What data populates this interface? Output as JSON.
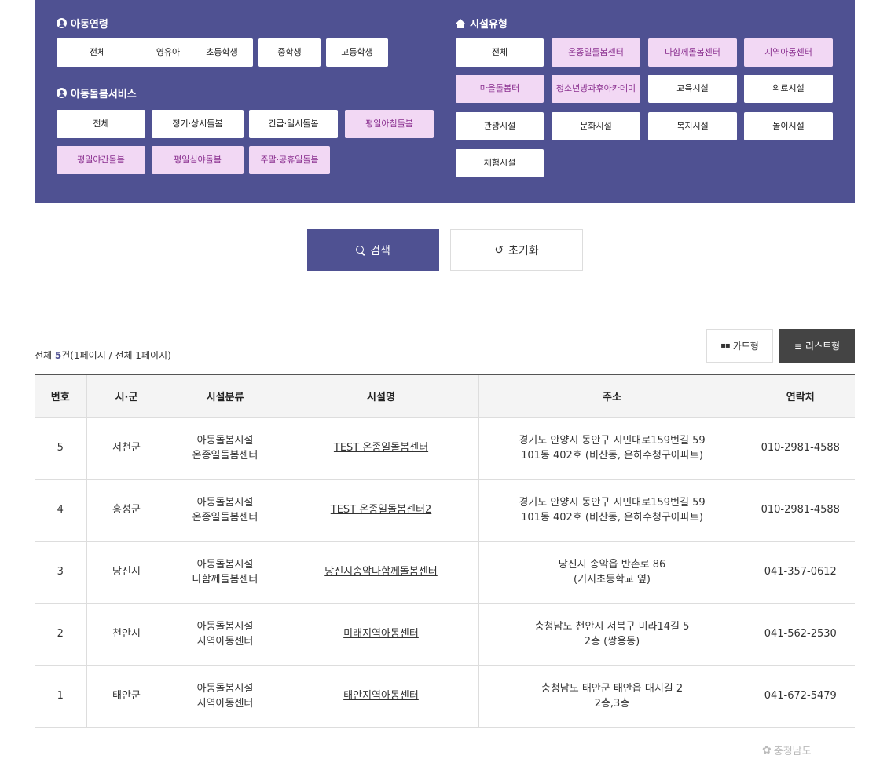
{
  "filters": {
    "age": {
      "title": "아동연령",
      "options": [
        "전체",
        "영유아",
        "초등학생",
        "중학생",
        "고등학생"
      ]
    },
    "service": {
      "title": "아동돌봄서비스",
      "options": [
        "전체",
        "정기·상시돌봄",
        "긴급·일시돌봄",
        "평일아침돌봄",
        "평일야간돌봄",
        "평일심야돌봄",
        "주말·공휴일돌봄"
      ]
    },
    "facility": {
      "title": "시설유형",
      "options": [
        "전체",
        "온종일돌봄센터",
        "다함께돌봄센터",
        "지역아동센터",
        "마을돌봄터",
        "청소년방과후아카데미",
        "교육시설",
        "의료시설",
        "관광시설",
        "문화시설",
        "복지시설",
        "놀이시설",
        "체험시설"
      ]
    },
    "selected_color": "#f2d8f4",
    "panel_color": "#4f5192"
  },
  "actions": {
    "search_label": "검색",
    "reset_label": "초기화"
  },
  "summary": {
    "prefix": "전체 ",
    "count": "5",
    "suffix": "건(1페이지 / 전체 1페이지)"
  },
  "view_toggle": {
    "card_label": "카드형",
    "list_label": "리스트형"
  },
  "table": {
    "headers": [
      "번호",
      "시·군",
      "시설분류",
      "시설명",
      "주소",
      "연락처"
    ],
    "rows": [
      {
        "no": "5",
        "region": "서천군",
        "category": "아동돌봄시설\n온종일돌봄센터",
        "name": "TEST 온종일돌봄센터",
        "address": "경기도 안양시 동안구 시민대로159번길 59\n101동 402호 (비산동, 은하수청구아파트)",
        "phone": "010-2981-4588"
      },
      {
        "no": "4",
        "region": "홍성군",
        "category": "아동돌봄시설\n온종일돌봄센터",
        "name": "TEST 온종일돌봄센터2",
        "address": "경기도 안양시 동안구 시민대로159번길 59\n101동 402호 (비산동, 은하수청구아파트)",
        "phone": "010-2981-4588"
      },
      {
        "no": "3",
        "region": "당진시",
        "category": "아동돌봄시설\n다함께돌봄센터",
        "name": "당진시송악다함께돌봄센터",
        "address": "당진시 송악읍 반촌로 86\n(기지초등학교 옆)",
        "phone": "041-357-0612"
      },
      {
        "no": "2",
        "region": "천안시",
        "category": "아동돌봄시설\n지역아동센터",
        "name": "미래지역아동센터",
        "address": "충청남도 천안시 서북구 미라14길 5\n2층 (쌍용동)",
        "phone": "041-562-2530"
      },
      {
        "no": "1",
        "region": "태안군",
        "category": "아동돌봄시설\n지역아동센터",
        "name": "태안지역아동센터",
        "address": "충청남도 태안군 태안읍 대지길 2\n2층,3층",
        "phone": "041-672-5479"
      }
    ]
  },
  "watermark": "충청남도"
}
